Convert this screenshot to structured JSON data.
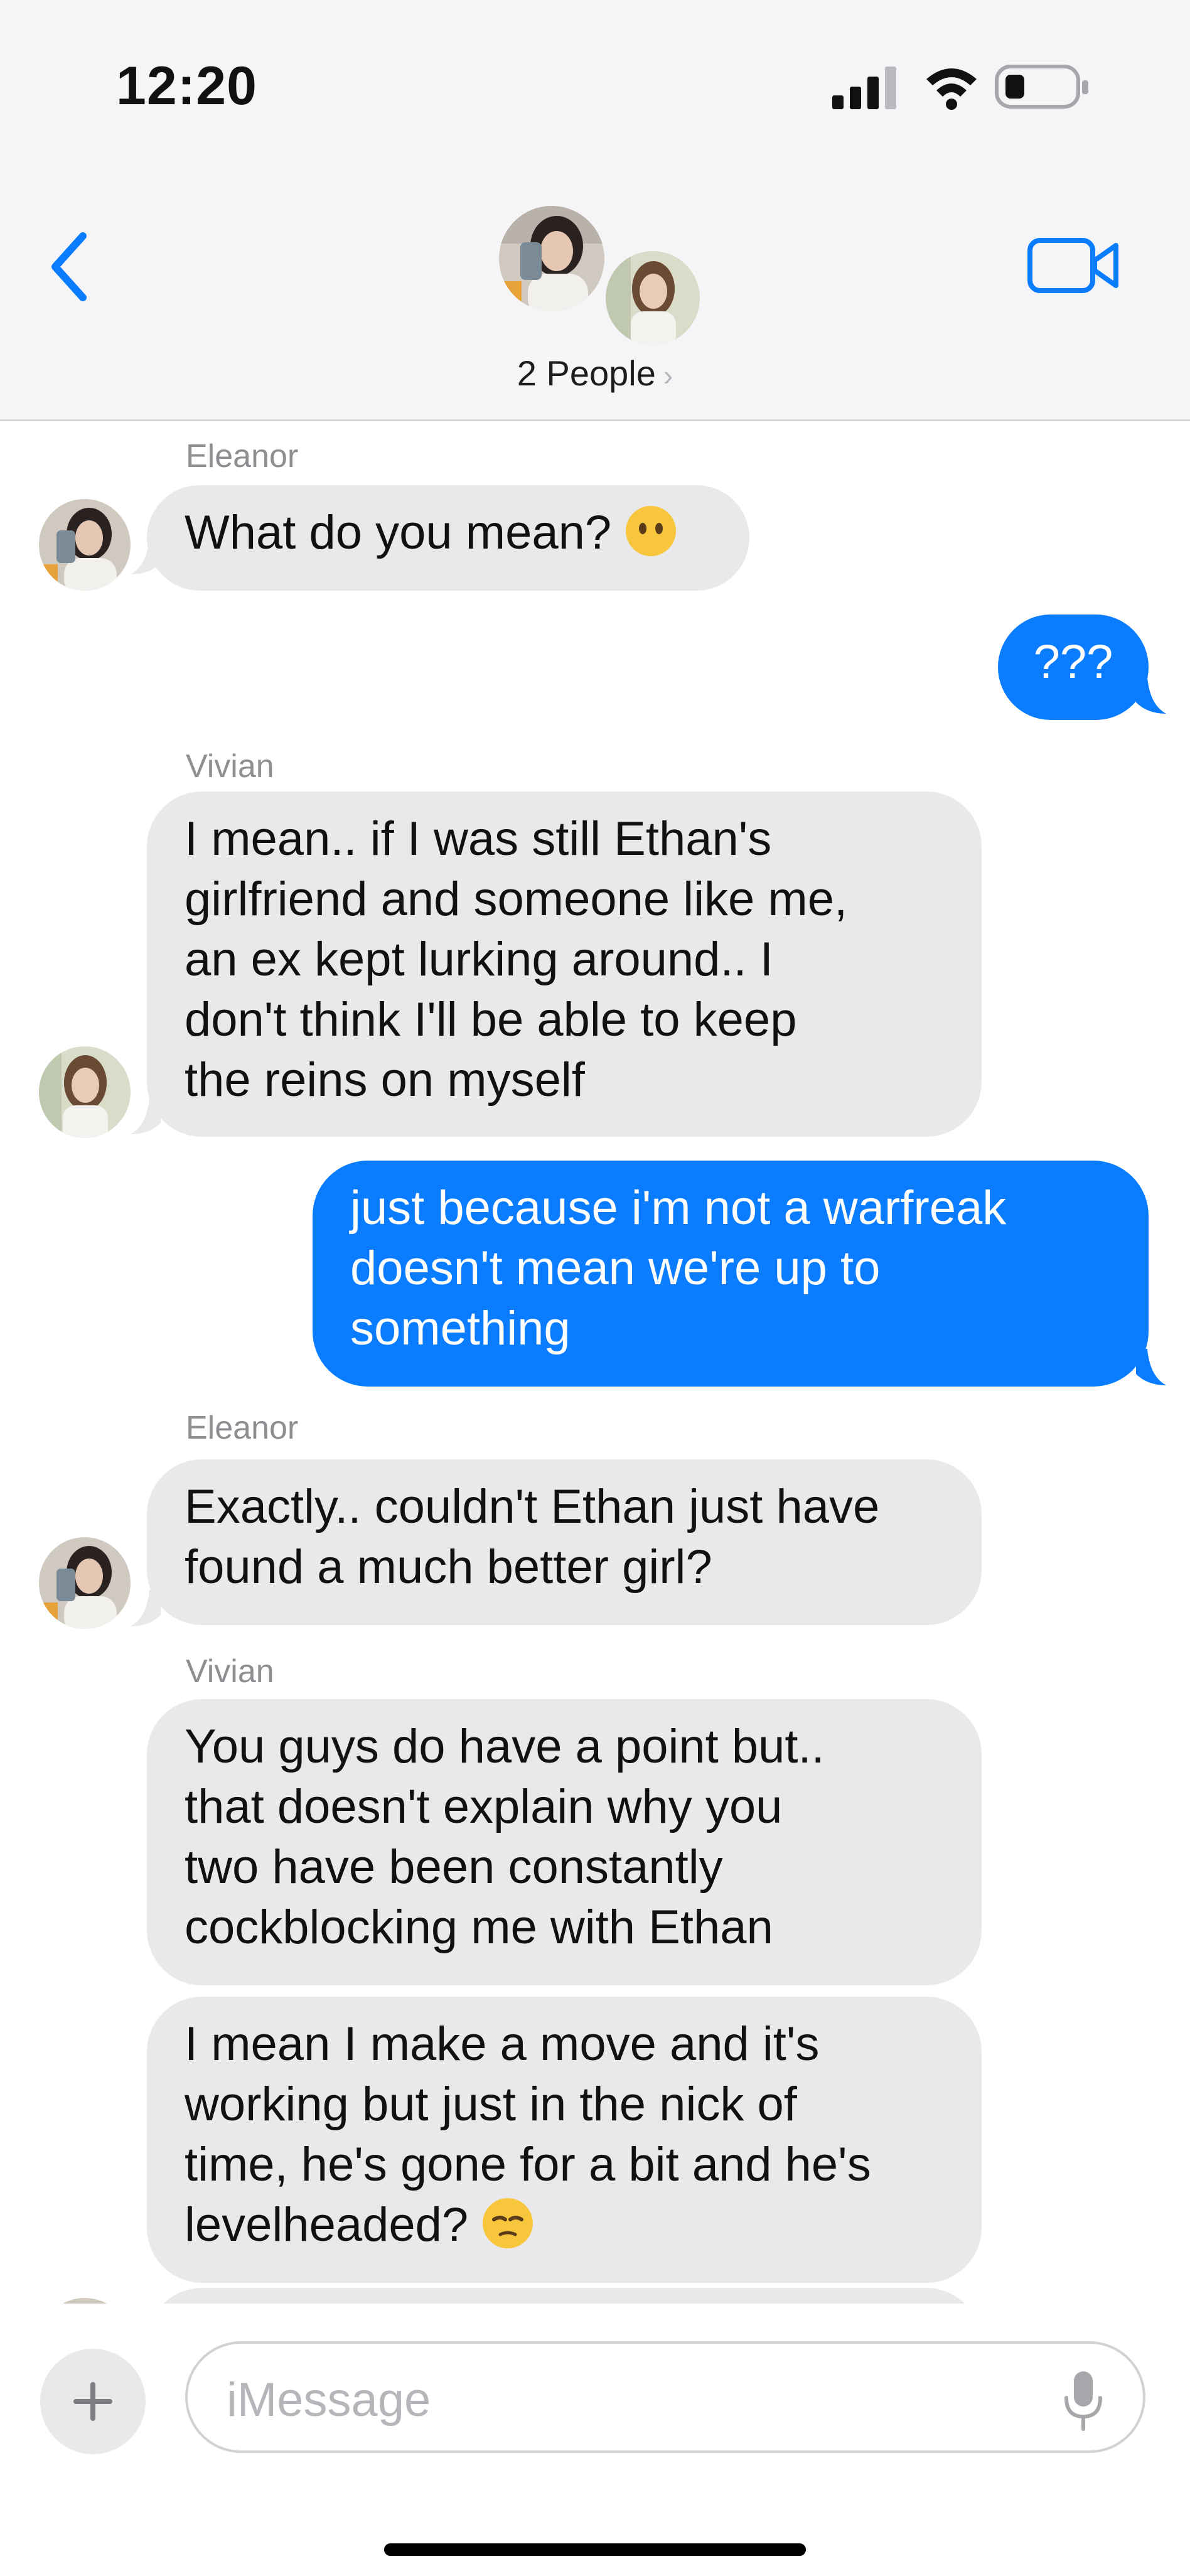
{
  "status_bar": {
    "time": "12:20"
  },
  "header": {
    "title": "2 People",
    "chevron": "›"
  },
  "messages": [
    {
      "sender": "Eleanor",
      "text": "What do you mean? ",
      "emoji": "neutral-face-emoji"
    },
    {
      "text": "???"
    },
    {
      "sender": "Vivian",
      "lines": [
        "I mean.. if I was still Ethan's",
        "girlfriend and someone like me,",
        "an ex kept lurking around.. I",
        "don't think I'll be able to keep",
        "the reins on myself"
      ]
    },
    {
      "lines": [
        "just because i'm not a warfreak",
        "doesn't mean we're up to",
        "something"
      ]
    },
    {
      "sender": "Eleanor",
      "lines": [
        "Exactly.. couldn't Ethan just have",
        "found a much better girl?"
      ]
    },
    {
      "sender": "Vivian",
      "lines": [
        "You guys do have a point but..",
        "that doesn't explain why you",
        "two have been constantly",
        "cockblocking me with Ethan"
      ]
    },
    {
      "lines": [
        "I mean I make a move and it's",
        "working but just in the nick of",
        "time, he's gone for a bit and he's",
        "levelheaded? "
      ],
      "emoji": "unamused-face-emoji"
    }
  ],
  "input": {
    "placeholder": "iMessage",
    "add_icon": "plus-icon",
    "mic_icon": "microphone-icon"
  },
  "colors": {
    "accent": "#0a7cff",
    "incoming": "#e9e9eb",
    "header_bg": "#f5f5f7"
  }
}
